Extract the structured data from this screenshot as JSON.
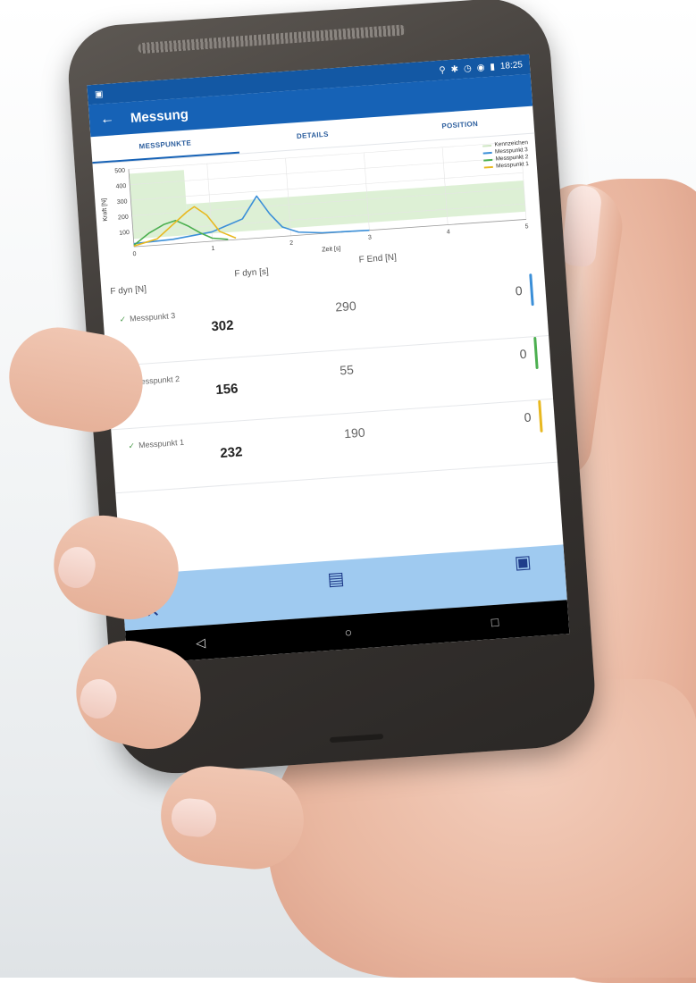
{
  "status_bar": {
    "time": "18:25",
    "icons": [
      "location-icon",
      "bluetooth-icon",
      "alarm-icon",
      "wifi-icon",
      "battery-icon"
    ]
  },
  "app_bar": {
    "title": "Messung"
  },
  "tabs": [
    {
      "label": "MESSPUNKTE",
      "active": true
    },
    {
      "label": "DETAILS",
      "active": false
    },
    {
      "label": "POSITION",
      "active": false
    }
  ],
  "chart_data": {
    "type": "line",
    "xlabel": "Zeit [s]",
    "ylabel": "Kraft [N]",
    "xlim": [
      0,
      5
    ],
    "ylim": [
      0,
      500
    ],
    "x_ticks": [
      "0",
      "1",
      "2",
      "3",
      "4",
      "5"
    ],
    "y_ticks": [
      "100",
      "200",
      "300",
      "400",
      "500"
    ],
    "legend": [
      "Kennzeichen",
      "Messpunkt 3",
      "Messpunkt 2",
      "Messpunkt 1"
    ],
    "series": [
      {
        "name": "Messpunkt 3",
        "color": "#3b8fd8",
        "x": [
          0,
          0.5,
          1.0,
          1.4,
          1.6,
          1.75,
          1.9,
          2.1,
          2.4,
          3.0
        ],
        "y": [
          20,
          30,
          60,
          130,
          270,
          150,
          60,
          20,
          5,
          0
        ]
      },
      {
        "name": "Messpunkt 2",
        "color": "#4caf50",
        "x": [
          0,
          0.2,
          0.4,
          0.55,
          0.7,
          0.85,
          1.0,
          1.2
        ],
        "y": [
          10,
          80,
          130,
          150,
          110,
          60,
          20,
          5
        ]
      },
      {
        "name": "Messpunkt 1",
        "color": "#e8b820",
        "x": [
          0,
          0.3,
          0.5,
          0.7,
          0.8,
          0.95,
          1.1,
          1.3
        ],
        "y": [
          5,
          40,
          120,
          200,
          230,
          170,
          60,
          10
        ]
      }
    ],
    "bands": [
      {
        "x": [
          0,
          0.7
        ],
        "y": [
          50,
          470
        ]
      },
      {
        "x": [
          0.7,
          5
        ],
        "y": [
          50,
          250
        ]
      }
    ]
  },
  "columns": {
    "fdyn_n": "F dyn [N]",
    "fdyn_s": "F dyn [s]",
    "fend_n": "F End [N]"
  },
  "measurements": [
    {
      "name": "Messpunkt 3",
      "fdyn_n": "302",
      "fend_n": "290",
      "count": "0",
      "color": "#3b8fd8"
    },
    {
      "name": "Messpunkt 2",
      "fdyn_n": "156",
      "fend_n": "55",
      "count": "0",
      "color": "#4caf50"
    },
    {
      "name": "Messpunkt 1",
      "fdyn_n": "232",
      "fend_n": "190",
      "count": "0",
      "color": "#e8b820"
    }
  ],
  "bottom_actions": {
    "cancel": "close-icon",
    "report": "clipboard-icon",
    "save": "save-icon"
  },
  "navigation": {
    "back": "back-triangle-icon",
    "home": "home-circle-icon",
    "recents": "recents-square-icon"
  }
}
